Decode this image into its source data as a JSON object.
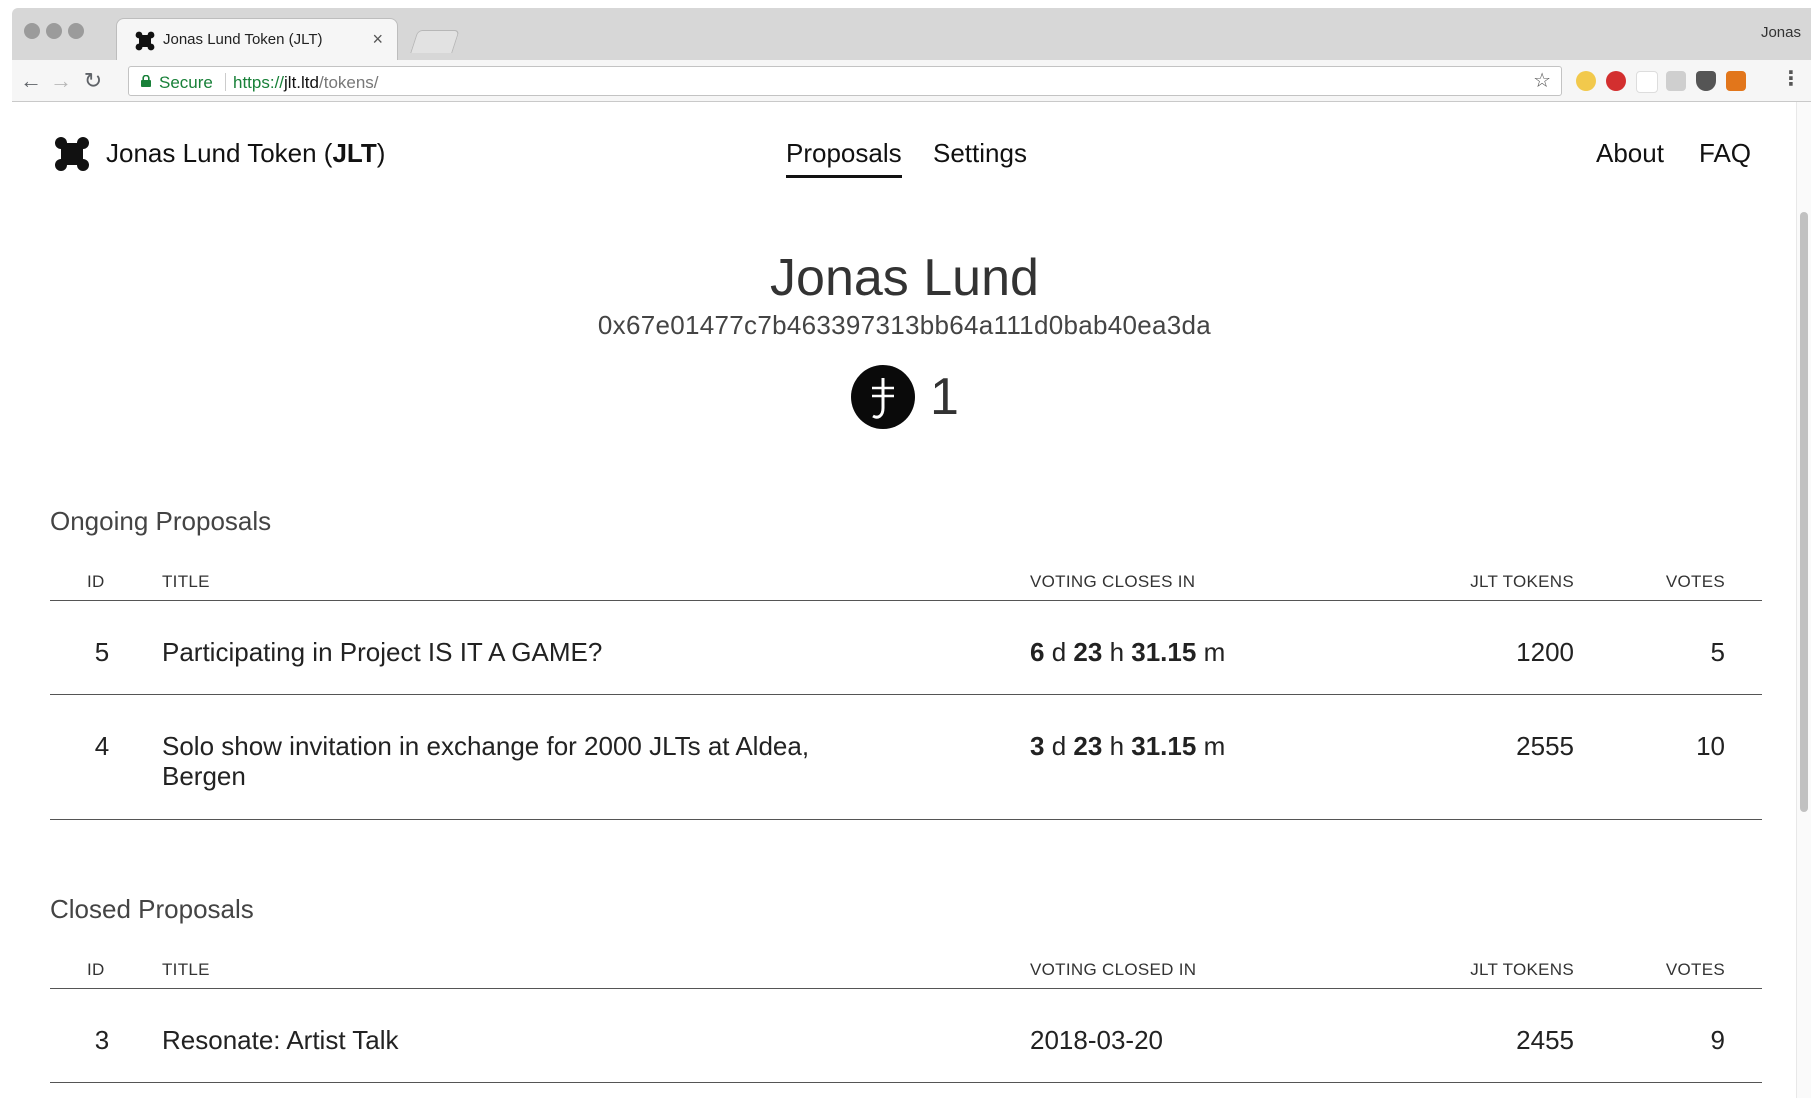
{
  "browser": {
    "tab_title": "Jonas Lund Token (JLT)",
    "tab_close": "×",
    "profile": "Jonas",
    "secure_label": "Secure",
    "url_scheme": "https://",
    "url_host": "jlt.ltd",
    "url_path": "/tokens/"
  },
  "site": {
    "title_prefix": "Jonas Lund Token (",
    "title_bold": "JLT",
    "title_suffix": ")",
    "nav_center": [
      "Proposals",
      "Settings"
    ],
    "nav_right": [
      "About",
      "FAQ"
    ],
    "active_nav": "Proposals"
  },
  "profile": {
    "name": "Jonas Lund",
    "wallet": "0x67e01477c7b463397313bb64a111d0bab40ea3da",
    "token_count": "1"
  },
  "ongoing": {
    "title": "Ongoing Proposals",
    "columns": [
      "ID",
      "TITLE",
      "VOTING CLOSES IN",
      "JLT TOKENS",
      "VOTES"
    ],
    "rows": [
      {
        "id": "5",
        "title": "Participating in Project IS IT A GAME?",
        "days": "6",
        "hours": "23",
        "minutes": "31.15",
        "tokens": "1200",
        "votes": "5"
      },
      {
        "id": "4",
        "title": "Solo show invitation in exchange for 2000 JLTs at Aldea, Bergen",
        "days": "3",
        "hours": "23",
        "minutes": "31.15",
        "tokens": "2555",
        "votes": "10"
      }
    ],
    "unit_d": "d",
    "unit_h": "h",
    "unit_m": "m"
  },
  "closed": {
    "title": "Closed Proposals",
    "columns": [
      "ID",
      "TITLE",
      "VOTING CLOSED IN",
      "JLT TOKENS",
      "VOTES"
    ],
    "rows": [
      {
        "id": "3",
        "title": "Resonate: Artist Talk",
        "closed": "2018-03-20",
        "tokens": "2455",
        "votes": "9"
      }
    ]
  }
}
